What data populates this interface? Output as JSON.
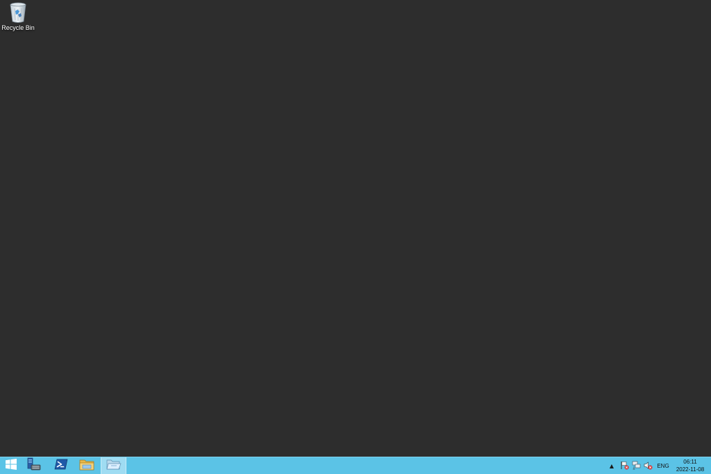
{
  "desktop": {
    "background_color": "#2d2d2d",
    "icons": [
      {
        "label": "Recycle Bin",
        "icon": "recycle-bin-icon"
      }
    ]
  },
  "taskbar": {
    "background_color": "#5bc3e6",
    "buttons": [
      {
        "icon": "windows-start-icon"
      },
      {
        "icon": "server-manager-icon"
      },
      {
        "icon": "powershell-icon"
      },
      {
        "icon": "file-explorer-icon"
      },
      {
        "icon": "open-folder-icon",
        "active": true
      }
    ],
    "tray": {
      "chevron": "▲",
      "icons": [
        "action-center-flag-icon",
        "network-icon",
        "volume-icon"
      ],
      "language": "ENG",
      "time": "06:11",
      "date": "2022-11-08"
    }
  }
}
